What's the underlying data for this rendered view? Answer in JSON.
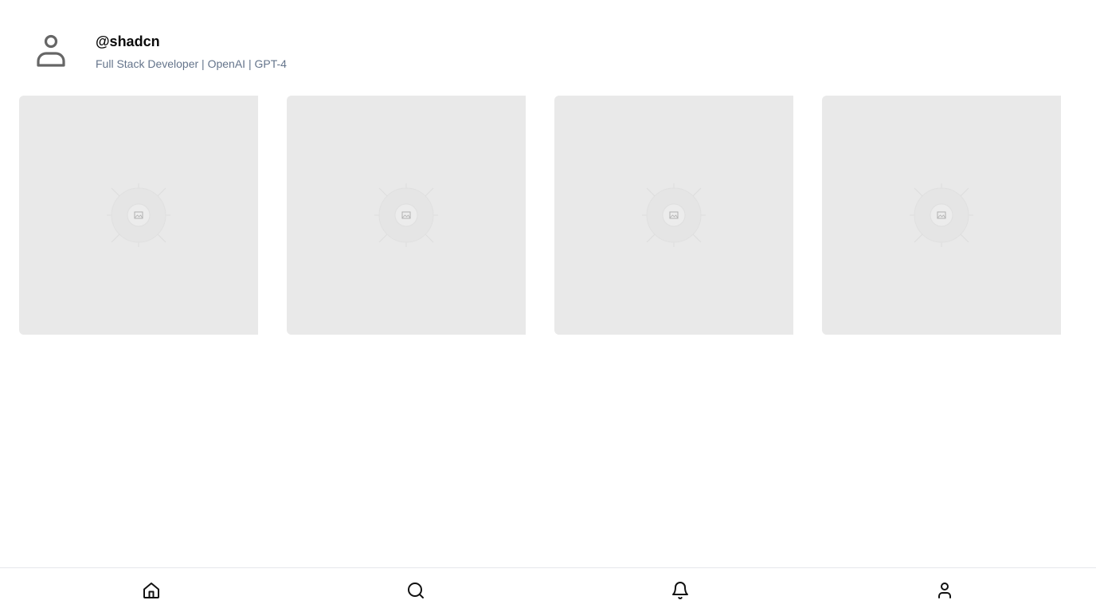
{
  "profile": {
    "handle": "@shadcn",
    "bio": "Full Stack Developer | OpenAI | GPT-4",
    "avatar_icon": "user-icon"
  },
  "posts": [
    {
      "placeholder_icon": "image-placeholder-icon"
    },
    {
      "placeholder_icon": "image-placeholder-icon"
    },
    {
      "placeholder_icon": "image-placeholder-icon"
    },
    {
      "placeholder_icon": "image-placeholder-icon"
    }
  ],
  "bottom_nav": {
    "items": [
      {
        "icon": "home-icon"
      },
      {
        "icon": "search-icon"
      },
      {
        "icon": "bell-icon"
      },
      {
        "icon": "user-icon"
      }
    ]
  },
  "colors": {
    "tile_background": "#e9e9e9",
    "bio_text": "#64748b",
    "nav_border": "#e5e7eb"
  }
}
